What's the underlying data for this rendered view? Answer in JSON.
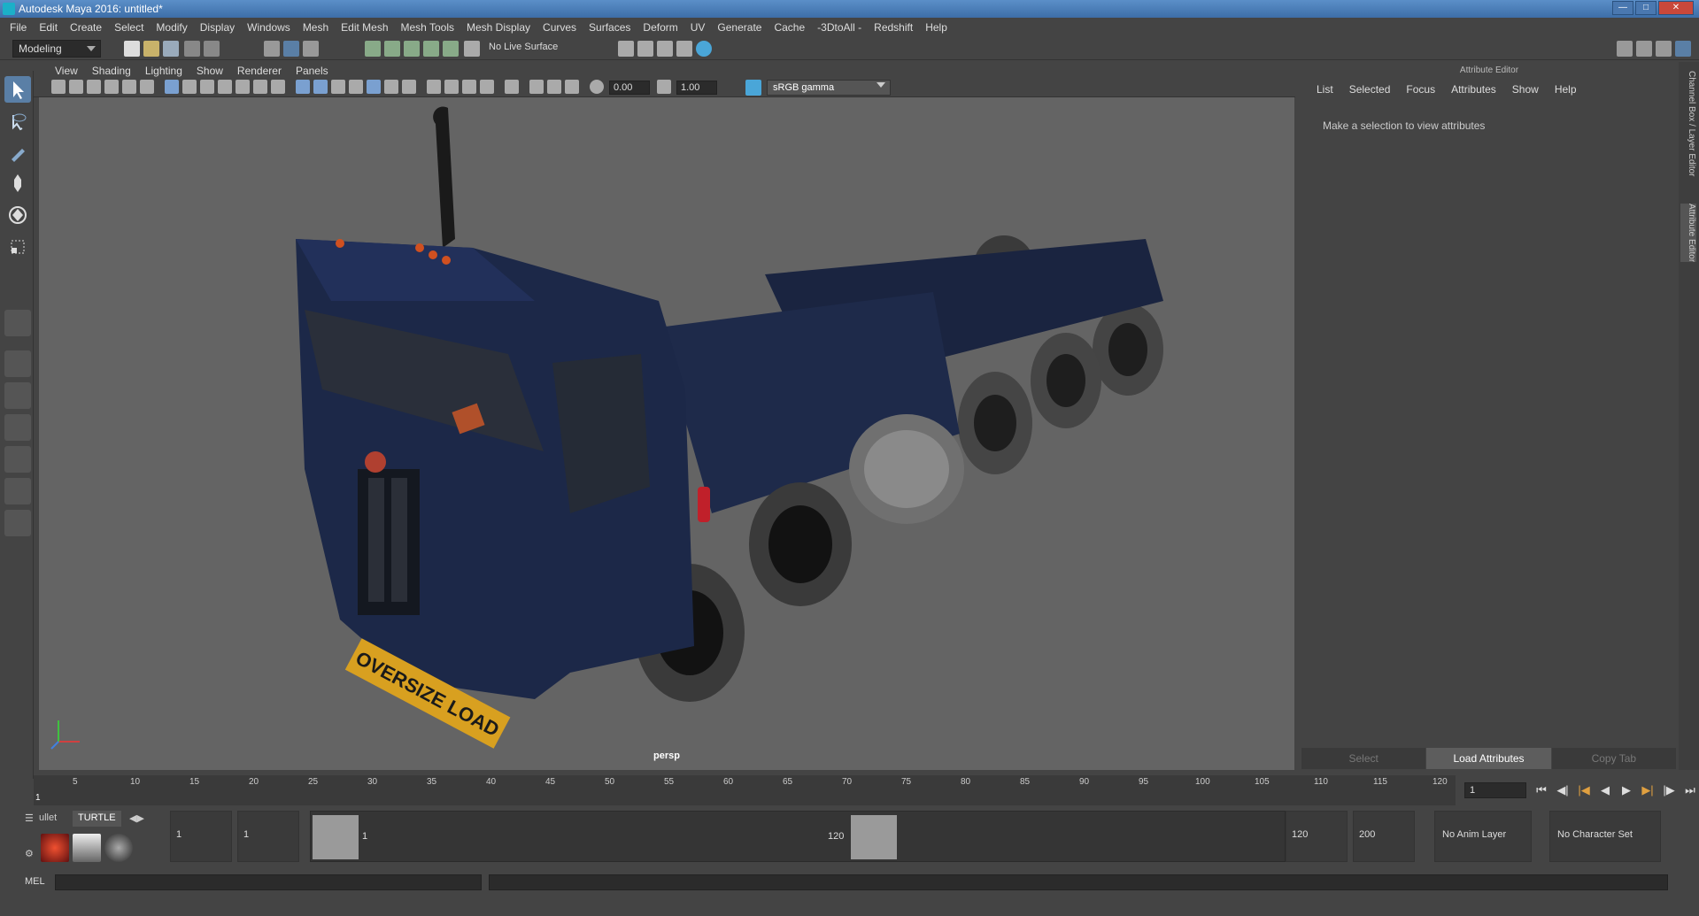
{
  "window": {
    "title": "Autodesk Maya 2016: untitled*"
  },
  "menus": [
    "File",
    "Edit",
    "Create",
    "Select",
    "Modify",
    "Display",
    "Windows",
    "Mesh",
    "Edit Mesh",
    "Mesh Tools",
    "Mesh Display",
    "Curves",
    "Surfaces",
    "Deform",
    "UV",
    "Generate",
    "Cache",
    "-3DtoAll -",
    "Redshift",
    "Help"
  ],
  "statusline": {
    "mode": "Modeling",
    "live_surface": "No Live Surface"
  },
  "viewport": {
    "menus": [
      "View",
      "Shading",
      "Lighting",
      "Show",
      "Renderer",
      "Panels"
    ],
    "exposure": "0.00",
    "gamma": "1.00",
    "colorspace": "sRGB gamma",
    "camera": "persp"
  },
  "truck": {
    "plate": "OVERSIZE LOAD"
  },
  "attribute_editor": {
    "title": "Attribute Editor",
    "menus": [
      "List",
      "Selected",
      "Focus",
      "Attributes",
      "Show",
      "Help"
    ],
    "message": "Make a selection to view attributes",
    "buttons": [
      "Select",
      "Load Attributes",
      "Copy Tab"
    ]
  },
  "side_tabs": [
    "Channel Box / Layer Editor",
    "Attribute Editor"
  ],
  "timeline": {
    "ticks": [
      "5",
      "10",
      "15",
      "20",
      "25",
      "30",
      "35",
      "40",
      "45",
      "50",
      "55",
      "60",
      "65",
      "70",
      "75",
      "80",
      "85",
      "90",
      "95",
      "100",
      "105",
      "110",
      "115",
      "120"
    ],
    "current_frame": "1",
    "current_time_field": "1"
  },
  "shelf": {
    "tabs": [
      "ullet",
      "TURTLE"
    ]
  },
  "range": {
    "start": "1",
    "playback_start": "1",
    "range_start_label": "1",
    "range_end_label": "120",
    "playback_end": "120",
    "end": "200",
    "anim_layer": "No Anim Layer",
    "character_set": "No Character Set"
  },
  "cmdline": {
    "label": "MEL"
  }
}
